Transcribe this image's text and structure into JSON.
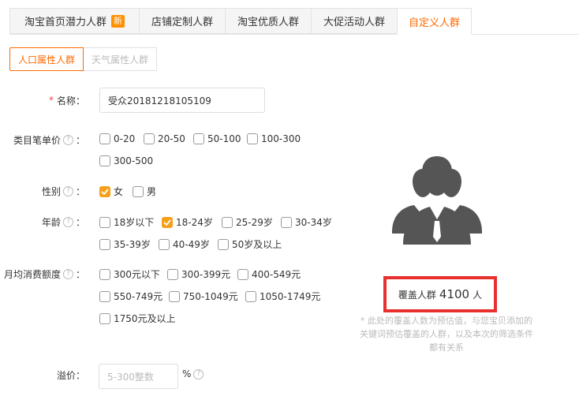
{
  "tabs": [
    {
      "label": "淘宝首页潜力人群",
      "badge": "新"
    },
    {
      "label": "店铺定制人群"
    },
    {
      "label": "淘宝优质人群"
    },
    {
      "label": "大促活动人群"
    },
    {
      "label": "自定义人群"
    }
  ],
  "subtabs": [
    "人口属性人群",
    "天气属性人群"
  ],
  "name": {
    "required_mark": "*",
    "label": "名称：",
    "value": "受众20181218105109"
  },
  "price": {
    "label": "类目笔单价",
    "suffix": "：",
    "options": [
      "0-20",
      "20-50",
      "50-100",
      "100-300",
      "300-500"
    ]
  },
  "gender": {
    "label": "性别",
    "suffix": "：",
    "options": [
      "女",
      "男"
    ],
    "checked": [
      "女"
    ]
  },
  "age": {
    "label": "年龄",
    "suffix": "：",
    "options": [
      "18岁以下",
      "18-24岁",
      "25-29岁",
      "30-34岁",
      "35-39岁",
      "40-49岁",
      "50岁及以上"
    ],
    "checked": [
      "18-24岁"
    ]
  },
  "spend": {
    "label": "月均消费额度",
    "suffix": "：",
    "options": [
      "300元以下",
      "300-399元",
      "400-549元",
      "550-749元",
      "750-1049元",
      "1050-1749元",
      "1750元及以上"
    ]
  },
  "premium": {
    "label": "溢价：",
    "placeholder": "5-300整数",
    "unit": "%"
  },
  "coverage": {
    "label": "覆盖人群",
    "value": "4100",
    "unit": "人"
  },
  "note": {
    "line1": "* 此处的覆盖人数为预估值，与您宝贝添加的",
    "line2": "关键词预估覆盖的人群，以及本次的筛选条件",
    "line3": "都有关系"
  },
  "colors": {
    "accent": "#ff6a00",
    "checkbox": "#f6a019",
    "badge": "#ff9000",
    "highlight_border": "#e8312f",
    "icon": "#555555"
  },
  "icons": {
    "help": "question-circle-icon",
    "audience": "user-group-icon",
    "check": "checkmark-icon"
  }
}
